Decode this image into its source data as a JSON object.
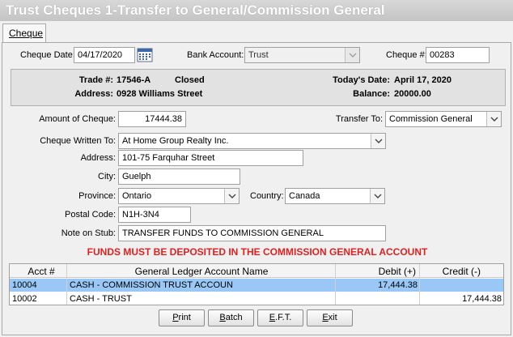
{
  "window": {
    "title": "Trust Cheques 1-Transfer to General/Commission General"
  },
  "tab": {
    "label": "Cheque"
  },
  "cheque": {
    "date_label": "Cheque Date:",
    "date_value": "04/17/2020",
    "bank_label": "Bank Account:",
    "bank_value": "Trust",
    "number_label": "Cheque #:",
    "number_value": "00283"
  },
  "info": {
    "trade_label": "Trade #:",
    "trade_value": "17546-A",
    "status": "Closed",
    "address_label": "Address:",
    "address_value": "0928 Williams Street",
    "today_label": "Today's Date:",
    "today_value": "April 17, 2020",
    "balance_label": "Balance:",
    "balance_value": "20000.00"
  },
  "form": {
    "amount_label": "Amount of Cheque:",
    "amount_value": "17444.38",
    "transfer_label": "Transfer To:",
    "transfer_value": "Commission General",
    "payee_label": "Cheque Written To:",
    "payee_value": "At Home Group Realty Inc.",
    "address_label": "Address:",
    "address_value": "101-75 Farquhar Street",
    "city_label": "City:",
    "city_value": "Guelph",
    "province_label": "Province:",
    "province_value": "Ontario",
    "country_label": "Country:",
    "country_value": "Canada",
    "postal_label": "Postal Code:",
    "postal_value": "N1H-3N4",
    "stub_label": "Note on Stub:",
    "stub_value": "TRANSFER FUNDS TO COMMISSION GENERAL"
  },
  "warning": "FUNDS MUST BE DEPOSITED IN THE COMMISSION GENERAL ACCOUNT",
  "grid": {
    "headers": {
      "acct": "Acct #",
      "name": "General Ledger Account Name",
      "debit": "Debit (+)",
      "credit": "Credit (-)"
    },
    "rows": [
      {
        "acct": "10004",
        "name": "CASH - COMMISSION TRUST ACCOUN",
        "debit": "17,444.38",
        "credit": ""
      },
      {
        "acct": "10002",
        "name": "CASH - TRUST",
        "debit": "",
        "credit": "17,444.38"
      }
    ]
  },
  "buttons": {
    "print": {
      "hot": "P",
      "rest": "rint"
    },
    "batch": {
      "hot": "B",
      "rest": "atch"
    },
    "eft": {
      "hot": "E",
      "rest": ".F.T."
    },
    "exit": {
      "hot": "E",
      "rest": "xit"
    }
  },
  "colors": {
    "selection": "#99c8f6",
    "warning": "#e02020",
    "title_bg": "#c8c8c8"
  }
}
